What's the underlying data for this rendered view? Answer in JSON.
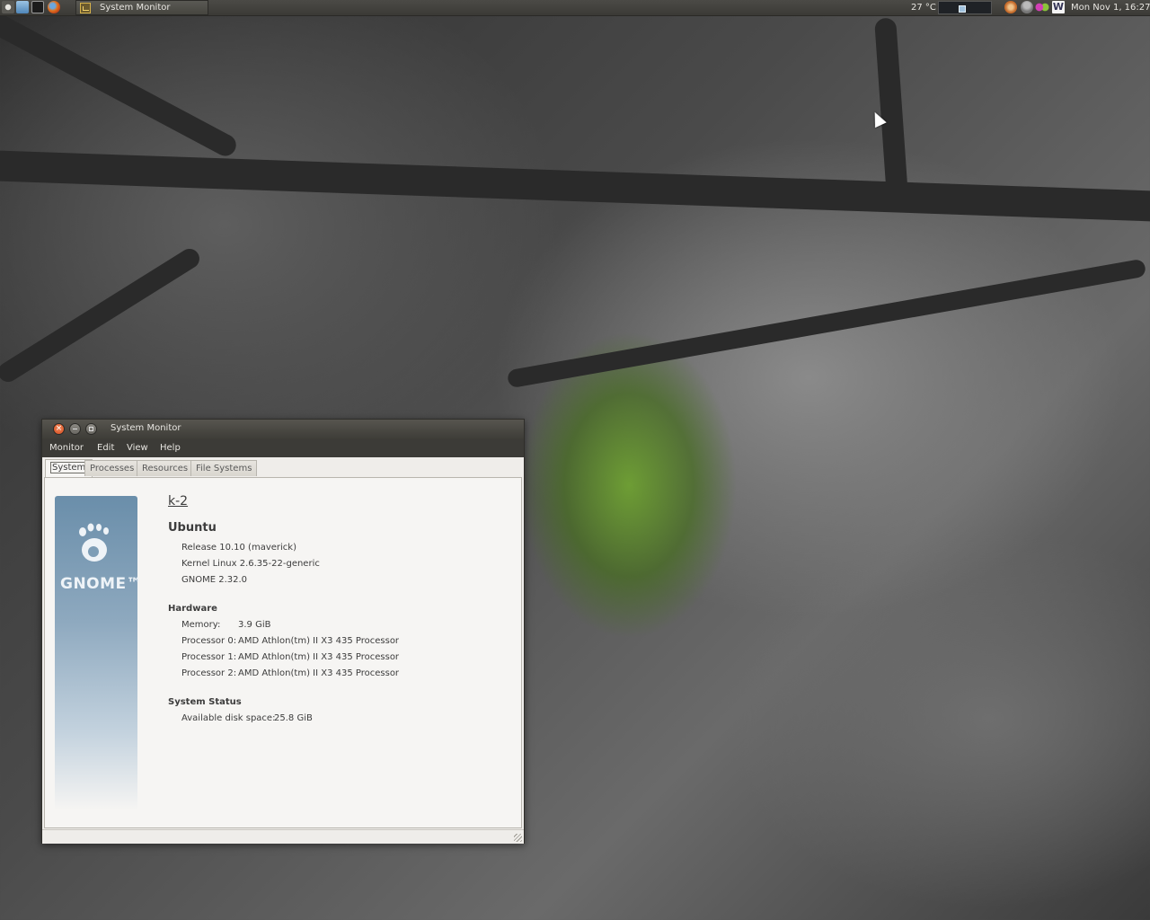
{
  "panel": {
    "task_title": "System Monitor",
    "temperature": "27 °C",
    "clock": "Mon Nov  1, 16:27",
    "launchers": [
      "ubuntu-logo-icon",
      "home-folder-icon",
      "terminal-icon",
      "firefox-icon"
    ],
    "tray_icons": [
      "wifi-icon",
      "user-icon",
      "chat-icon",
      "writer-icon"
    ]
  },
  "window": {
    "title": "System Monitor",
    "menu": {
      "monitor": "Monitor",
      "edit": "Edit",
      "view": "View",
      "help": "Help"
    },
    "tabs": {
      "system": "System",
      "processes": "Processes",
      "resources": "Resources",
      "file_systems": "File Systems"
    },
    "system": {
      "logo_text": "GNOME™",
      "hostname": "k-2",
      "distro": "Ubuntu",
      "release": "Release 10.10 (maverick)",
      "kernel": "Kernel Linux 2.6.35-22-generic",
      "gnome": "GNOME 2.32.0",
      "hardware_heading": "Hardware",
      "memory_label": "Memory:",
      "memory_value": "3.9 GiB",
      "processors": [
        {
          "label": "Processor 0:",
          "value": "AMD Athlon(tm) II X3 435 Processor"
        },
        {
          "label": "Processor 1:",
          "value": "AMD Athlon(tm) II X3 435 Processor"
        },
        {
          "label": "Processor 2:",
          "value": "AMD Athlon(tm) II X3 435 Processor"
        }
      ],
      "status_heading": "System Status",
      "disk_label": "Available disk space:",
      "disk_value": "25.8 GiB"
    }
  },
  "colors": {
    "panel_bg": "#3c3b37",
    "logo_blue": "#6a8eaa",
    "close_orange": "#e05a27"
  }
}
